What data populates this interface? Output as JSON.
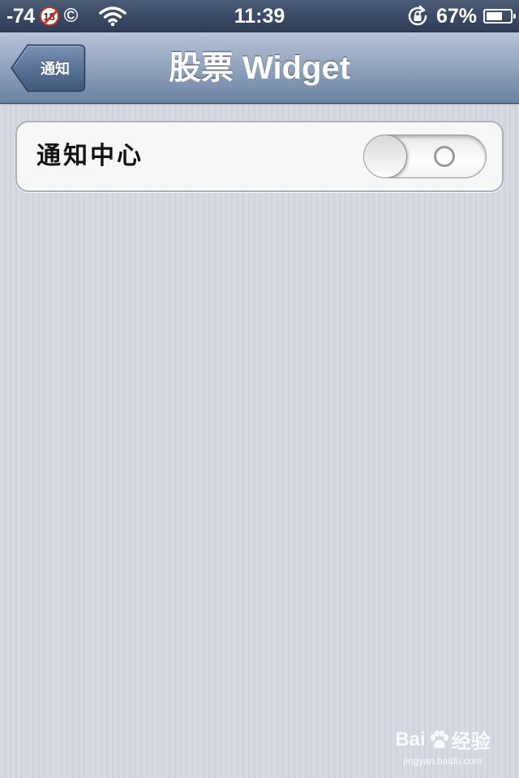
{
  "status_bar": {
    "signal_text": "-74",
    "badge_text": "18",
    "copyright_symbol": "©",
    "time": "11:39",
    "battery_text": "67%",
    "battery_level": 0.67,
    "icons": [
      "age-18-badge-icon",
      "copyright-icon",
      "wifi-icon",
      "rotation-lock-icon",
      "battery-icon"
    ]
  },
  "nav_bar": {
    "back_label": "通知",
    "title": "股票 Widget",
    "background_color": "#8497b4"
  },
  "settings": {
    "rows": [
      {
        "label": "通知中心",
        "toggle_on": false
      }
    ]
  },
  "watermark": {
    "logo_text_left": "Bai",
    "logo_text_right": "经验",
    "url": "jingyan.baidu.com"
  }
}
